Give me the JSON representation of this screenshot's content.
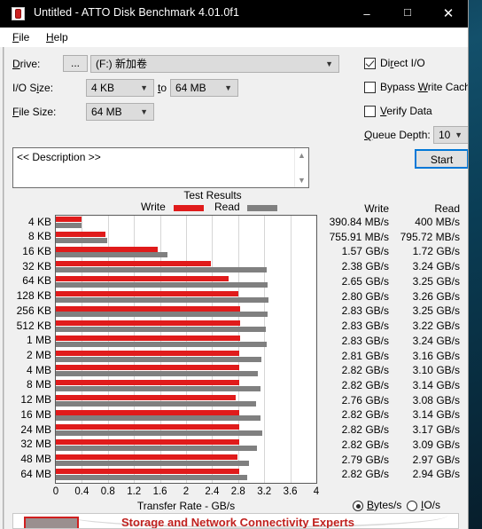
{
  "window": {
    "title": "Untitled - ATTO Disk Benchmark 4.01.0f1",
    "icon": "atto-app-icon",
    "minimize": "–",
    "maximize": "☐",
    "close": "✕"
  },
  "menu": {
    "items": [
      {
        "label": "File",
        "accel": "F"
      },
      {
        "label": "Help",
        "accel": "H"
      }
    ]
  },
  "form": {
    "drive_label": "Drive:",
    "drive_browse": "...",
    "drive_value": "(F:) 新加卷",
    "io_size_label": "I/O Size:",
    "io_size_from": "4 KB",
    "io_size_to_label": "to",
    "io_size_to": "64 MB",
    "file_size_label": "File Size:",
    "file_size_value": "64 MB",
    "direct_io_label": "Direct I/O",
    "direct_io_checked": true,
    "bypass_cache_label": "Bypass Write Cache",
    "bypass_cache_checked": false,
    "verify_data_label": "Verify Data",
    "verify_data_checked": false,
    "queue_depth_label": "Queue Depth:",
    "queue_depth_value": "10",
    "start_label": "Start",
    "description_value": "<< Description >>"
  },
  "units": {
    "bytes_label": "Bytes/s",
    "io_label": "IO/s",
    "selected": "Bytes/s"
  },
  "table": {
    "write_header": "Write",
    "read_header": "Read"
  },
  "banner": {
    "text": "Storage and Network Connectivity Experts"
  },
  "colors": {
    "write": "#e01b1b",
    "read": "#808080",
    "accent": "#0078d7",
    "banner_text": "#c0211f"
  },
  "chart_data": {
    "type": "bar",
    "title": "Test Results",
    "xlabel": "Transfer Rate - GB/s",
    "ylabel": "",
    "xlim": [
      0,
      4
    ],
    "xticks": [
      "0",
      "0.4",
      "0.8",
      "1.2",
      "1.6",
      "2",
      "2.4",
      "2.8",
      "3.2",
      "3.6",
      "4"
    ],
    "grid": true,
    "legend": [
      "Write",
      "Read"
    ],
    "legend_position": "above-plot",
    "categories": [
      "4 KB",
      "8 KB",
      "16 KB",
      "32 KB",
      "64 KB",
      "128 KB",
      "256 KB",
      "512 KB",
      "1 MB",
      "2 MB",
      "4 MB",
      "8 MB",
      "12 MB",
      "16 MB",
      "24 MB",
      "32 MB",
      "48 MB",
      "64 MB"
    ],
    "series": [
      {
        "name": "Write",
        "color": "#e01b1b",
        "values": [
          0.39084,
          0.75591,
          1.57,
          2.38,
          2.65,
          2.8,
          2.83,
          2.83,
          2.83,
          2.81,
          2.82,
          2.82,
          2.76,
          2.82,
          2.82,
          2.82,
          2.79,
          2.82
        ],
        "labels": [
          "390.84 MB/s",
          "755.91 MB/s",
          "1.57 GB/s",
          "2.38 GB/s",
          "2.65 GB/s",
          "2.80 GB/s",
          "2.83 GB/s",
          "2.83 GB/s",
          "2.83 GB/s",
          "2.81 GB/s",
          "2.82 GB/s",
          "2.82 GB/s",
          "2.76 GB/s",
          "2.82 GB/s",
          "2.82 GB/s",
          "2.82 GB/s",
          "2.79 GB/s",
          "2.82 GB/s"
        ]
      },
      {
        "name": "Read",
        "color": "#808080",
        "values": [
          0.4,
          0.79572,
          1.72,
          3.24,
          3.25,
          3.26,
          3.25,
          3.22,
          3.24,
          3.16,
          3.1,
          3.14,
          3.08,
          3.14,
          3.17,
          3.09,
          2.97,
          2.94
        ],
        "labels": [
          "400 MB/s",
          "795.72 MB/s",
          "1.72 GB/s",
          "3.24 GB/s",
          "3.25 GB/s",
          "3.26 GB/s",
          "3.25 GB/s",
          "3.22 GB/s",
          "3.24 GB/s",
          "3.16 GB/s",
          "3.10 GB/s",
          "3.14 GB/s",
          "3.08 GB/s",
          "3.14 GB/s",
          "3.17 GB/s",
          "3.09 GB/s",
          "2.97 GB/s",
          "2.94 GB/s"
        ]
      }
    ]
  }
}
